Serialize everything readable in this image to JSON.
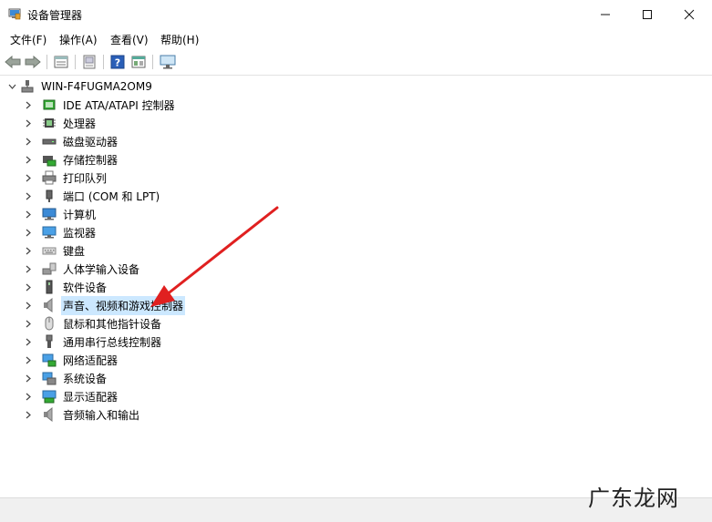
{
  "window": {
    "title": "设备管理器"
  },
  "menu": [
    "文件(F)",
    "操作(A)",
    "查看(V)",
    "帮助(H)"
  ],
  "toolbar": [
    "back-icon",
    "forward-icon",
    "properties-icon",
    "update-icon",
    "help-icon",
    "show-hidden-icon",
    "monitor-icon"
  ],
  "tree": {
    "root": "WIN-F4FUGMA2OM9",
    "items": [
      {
        "label": "IDE ATA/ATAPI 控制器",
        "icon": "ide-controller-icon"
      },
      {
        "label": "处理器",
        "icon": "processor-icon"
      },
      {
        "label": "磁盘驱动器",
        "icon": "disk-drive-icon"
      },
      {
        "label": "存储控制器",
        "icon": "storage-controller-icon"
      },
      {
        "label": "打印队列",
        "icon": "printer-icon"
      },
      {
        "label": "端口 (COM 和 LPT)",
        "icon": "port-icon"
      },
      {
        "label": "计算机",
        "icon": "computer-icon"
      },
      {
        "label": "监视器",
        "icon": "monitor-icon"
      },
      {
        "label": "键盘",
        "icon": "keyboard-icon"
      },
      {
        "label": "人体学输入设备",
        "icon": "hid-icon"
      },
      {
        "label": "软件设备",
        "icon": "software-device-icon"
      },
      {
        "label": "声音、视频和游戏控制器",
        "icon": "speaker-icon",
        "selected": true
      },
      {
        "label": "鼠标和其他指针设备",
        "icon": "mouse-icon"
      },
      {
        "label": "通用串行总线控制器",
        "icon": "usb-icon"
      },
      {
        "label": "网络适配器",
        "icon": "network-adapter-icon"
      },
      {
        "label": "系统设备",
        "icon": "system-device-icon"
      },
      {
        "label": "显示适配器",
        "icon": "display-adapter-icon"
      },
      {
        "label": "音频输入和输出",
        "icon": "audio-io-icon"
      }
    ]
  },
  "watermark": "广东龙网",
  "annotation": {
    "color": "#e02020"
  }
}
